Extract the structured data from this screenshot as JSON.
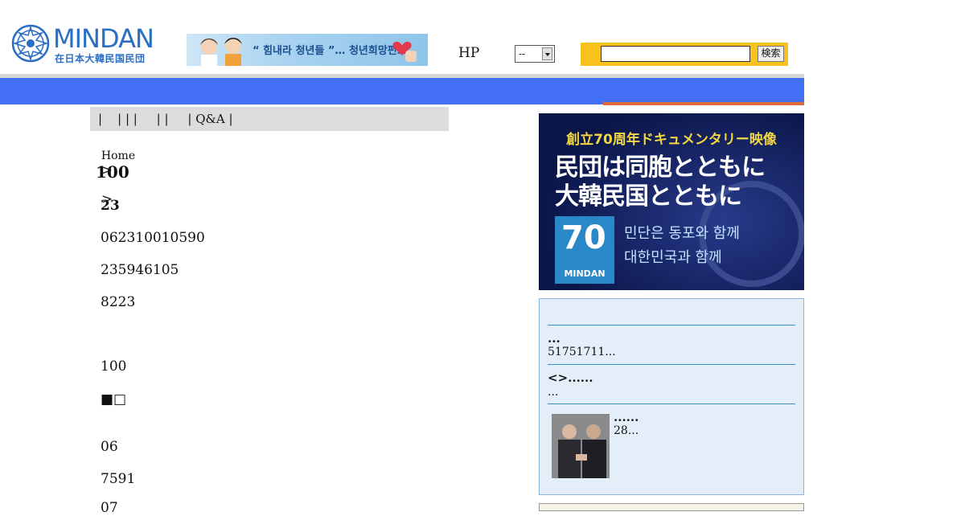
{
  "header": {
    "logo_text": "MINDAN",
    "logo_sub": "在日本大韓民国民団",
    "banner_text": "“ 힘내라 청년들 ”… 청년희망펀드",
    "hp_label": "HP",
    "lang_select_value": "--",
    "search_input_value": "",
    "search_button_label": "検索"
  },
  "subnav": {
    "text": "|    | | |     | |     | Q&A |"
  },
  "breadcrumb": {
    "home": "Home",
    "sep": ">"
  },
  "main": {
    "title": "100",
    "lines": [
      "23",
      "062310010590",
      "235946105",
      "8223",
      "100",
      "■□",
      "06",
      "7591",
      "07"
    ]
  },
  "sidebar": {
    "promo": {
      "headline": "創立70周年ドキュメンタリー映像",
      "line1": "民団は同胞とともに",
      "line2": "大韓民国とともに",
      "badge_number": "70",
      "badge_label": "MINDAN",
      "kr_line1": "민단은 동포와 함께",
      "kr_line2": "대한민국과 함께"
    },
    "news": [
      {
        "title": "...",
        "text": "51751711..."
      },
      {
        "title": "<>......",
        "text": "..."
      },
      {
        "title": "......",
        "text": "28..."
      }
    ]
  },
  "colors": {
    "nav_blue": "#4470f8",
    "accent_orange": "#e06b3a",
    "search_yellow": "#f7c21b",
    "logo_blue": "#2a6fc4"
  }
}
